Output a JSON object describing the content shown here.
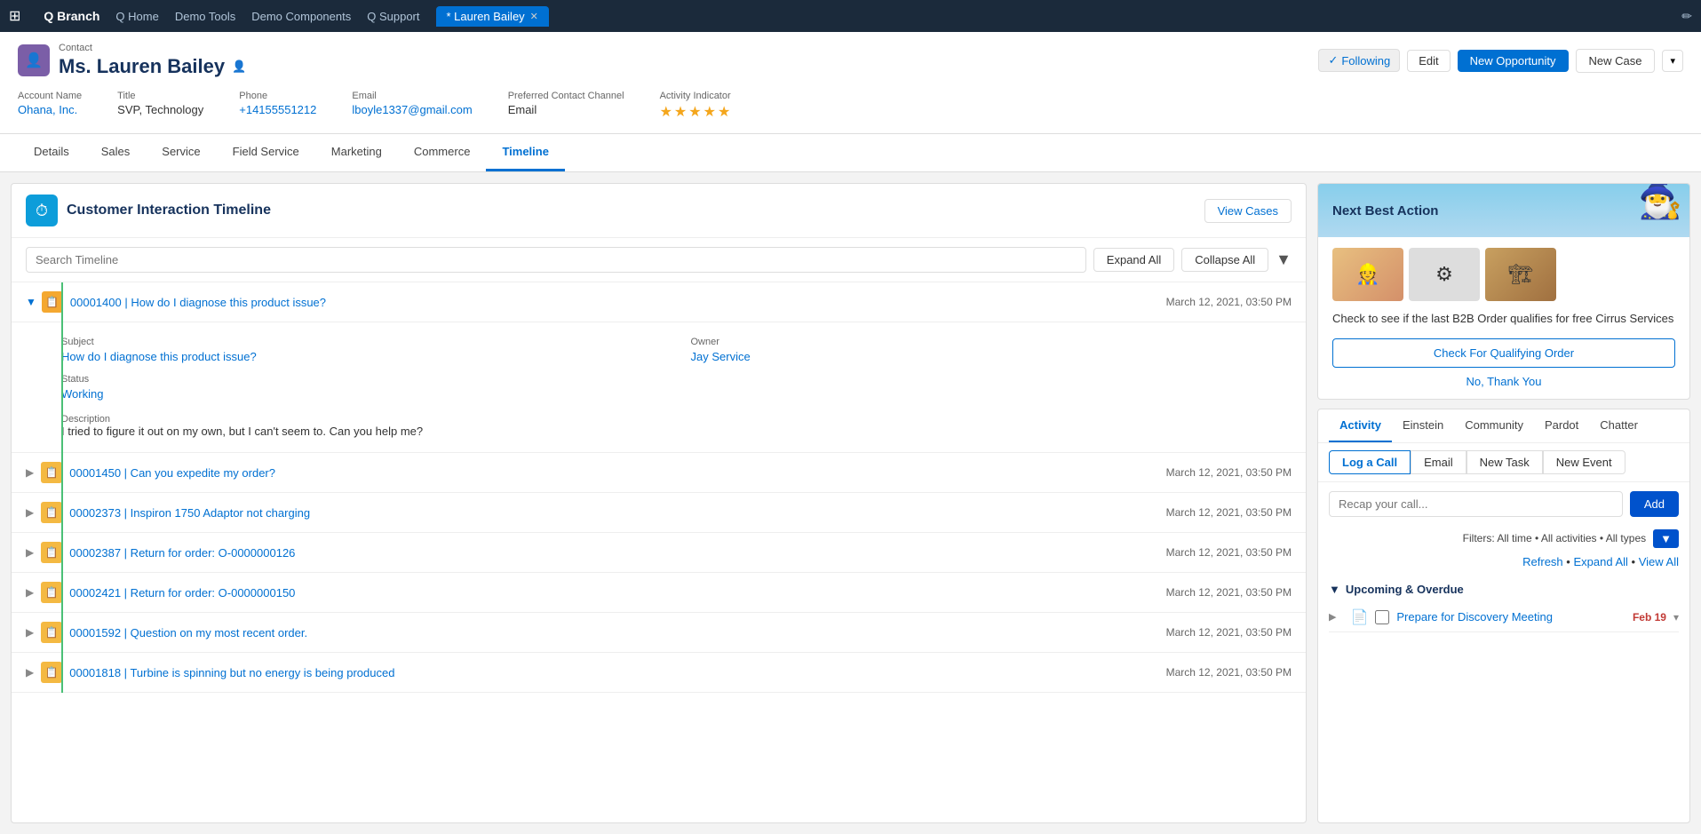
{
  "app": {
    "name": "Q Branch",
    "nav_items": [
      "Q Home",
      "Demo Tools",
      "Demo Components",
      "Q Support"
    ],
    "active_tab": "* Lauren Bailey",
    "pencil_label": "✏"
  },
  "record": {
    "type_label": "Contact",
    "name": "Ms. Lauren Bailey",
    "user_icon": "👤",
    "following_label": "Following",
    "edit_label": "Edit",
    "new_opportunity_label": "New Opportunity",
    "new_case_label": "New Case",
    "fields": {
      "account_name_label": "Account Name",
      "account_name_value": "Ohana, Inc.",
      "title_label": "Title",
      "title_value": "SVP, Technology",
      "phone_label": "Phone",
      "phone_value": "+14155551212",
      "email_label": "Email",
      "email_value": "lboyle1337@gmail.com",
      "pref_contact_label": "Preferred Contact Channel",
      "pref_contact_value": "Email",
      "activity_indicator_label": "Activity Indicator",
      "stars": "★★★★★"
    }
  },
  "tabs": [
    {
      "label": "Details",
      "active": false
    },
    {
      "label": "Sales",
      "active": false
    },
    {
      "label": "Service",
      "active": false
    },
    {
      "label": "Field Service",
      "active": false
    },
    {
      "label": "Marketing",
      "active": false
    },
    {
      "label": "Commerce",
      "active": false
    },
    {
      "label": "Timeline",
      "active": true
    }
  ],
  "timeline": {
    "title": "Customer Interaction Timeline",
    "view_cases_label": "View Cases",
    "search_placeholder": "Search Timeline",
    "expand_all_label": "Expand All",
    "collapse_all_label": "Collapse All",
    "cases": [
      {
        "id": "00001400",
        "title": "How do I diagnose this product issue?",
        "date": "March 12, 2021, 03:50 PM",
        "expanded": true,
        "subject": "How do I diagnose this product issue?",
        "owner": "Jay Service",
        "status": "Working",
        "description": "I tried to figure it out on my own, but I can't seem to. Can you help me?"
      },
      {
        "id": "00001450",
        "title": "Can you expedite my order?",
        "date": "March 12, 2021, 03:50 PM",
        "expanded": false
      },
      {
        "id": "00002373",
        "title": "Inspiron 1750 Adaptor not charging",
        "date": "March 12, 2021, 03:50 PM",
        "expanded": false
      },
      {
        "id": "00002387",
        "title": "Return for order: O-0000000126",
        "date": "March 12, 2021, 03:50 PM",
        "expanded": false
      },
      {
        "id": "00002421",
        "title": "Return for order: O-0000000150",
        "date": "March 12, 2021, 03:50 PM",
        "expanded": false
      },
      {
        "id": "00001592",
        "title": "Question on my most recent order.",
        "date": "March 12, 2021, 03:50 PM",
        "expanded": false
      },
      {
        "id": "00001818",
        "title": "Turbine is spinning but no energy is being produced",
        "date": "March 12, 2021, 03:50 PM",
        "expanded": false
      }
    ]
  },
  "nba": {
    "title": "Next Best Action",
    "einstein_icon": "🧙",
    "description": "Check to see if the last B2B Order qualifies for free Cirrus Services",
    "check_order_label": "Check For Qualifying Order",
    "no_thanks_label": "No, Thank You"
  },
  "activity": {
    "tabs": [
      {
        "label": "Activity",
        "active": true
      },
      {
        "label": "Einstein",
        "active": false
      },
      {
        "label": "Community",
        "active": false
      },
      {
        "label": "Pardot",
        "active": false
      },
      {
        "label": "Chatter",
        "active": false
      }
    ],
    "sub_tabs": [
      {
        "label": "Log a Call",
        "active": true
      },
      {
        "label": "Email",
        "active": false
      },
      {
        "label": "New Task",
        "active": false
      },
      {
        "label": "New Event",
        "active": false
      }
    ],
    "recap_placeholder": "Recap your call...",
    "add_label": "Add",
    "filter_text": "Filters: All time • All activities • All types",
    "refresh_label": "Refresh",
    "expand_all_label": "Expand All",
    "view_all_label": "View All",
    "upcoming_label": "Upcoming & Overdue",
    "upcoming_items": [
      {
        "title": "Prepare for Discovery Meeting",
        "date": "Feb 19",
        "date_color": "#c23934"
      }
    ]
  }
}
